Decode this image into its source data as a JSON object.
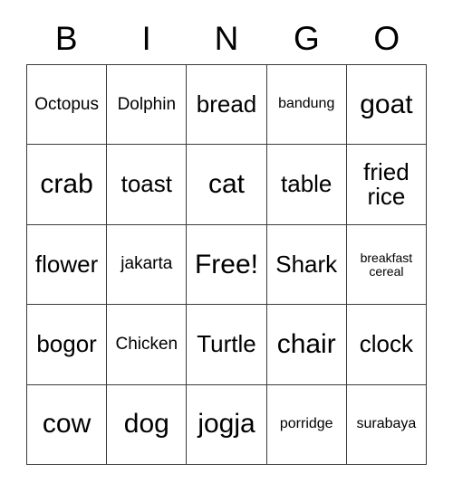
{
  "card": {
    "title": "BINGO",
    "header_letters": [
      "B",
      "I",
      "N",
      "G",
      "O"
    ],
    "free_space_label": "Free!",
    "colors": {
      "background": "#ffffff",
      "text": "#000000",
      "border": "#3a3a3a"
    },
    "grid": {
      "columns": 5,
      "rows": 5,
      "cells": [
        [
          {
            "label": "Octopus",
            "size": "fs-m"
          },
          {
            "label": "Dolphin",
            "size": "fs-m"
          },
          {
            "label": "bread",
            "size": "fs-l"
          },
          {
            "label": "bandung",
            "size": "fs-s"
          },
          {
            "label": "goat",
            "size": "fs-xl"
          }
        ],
        [
          {
            "label": "crab",
            "size": "fs-xl"
          },
          {
            "label": "toast",
            "size": "fs-l"
          },
          {
            "label": "cat",
            "size": "fs-xl"
          },
          {
            "label": "table",
            "size": "fs-l"
          },
          {
            "label": "fried rice",
            "size": "fs-l"
          }
        ],
        [
          {
            "label": "flower",
            "size": "fs-l"
          },
          {
            "label": "jakarta",
            "size": "fs-m"
          },
          {
            "label": "Free!",
            "size": "fs-xl"
          },
          {
            "label": "Shark",
            "size": "fs-l"
          },
          {
            "label": "breakfast cereal",
            "size": "fs-xs"
          }
        ],
        [
          {
            "label": "bogor",
            "size": "fs-l"
          },
          {
            "label": "Chicken",
            "size": "fs-m"
          },
          {
            "label": "Turtle",
            "size": "fs-l"
          },
          {
            "label": "chair",
            "size": "fs-xl"
          },
          {
            "label": "clock",
            "size": "fs-l"
          }
        ],
        [
          {
            "label": "cow",
            "size": "fs-xl"
          },
          {
            "label": "dog",
            "size": "fs-xl"
          },
          {
            "label": "jogja",
            "size": "fs-xl"
          },
          {
            "label": "porridge",
            "size": "fs-s"
          },
          {
            "label": "surabaya",
            "size": "fs-s"
          }
        ]
      ]
    }
  }
}
